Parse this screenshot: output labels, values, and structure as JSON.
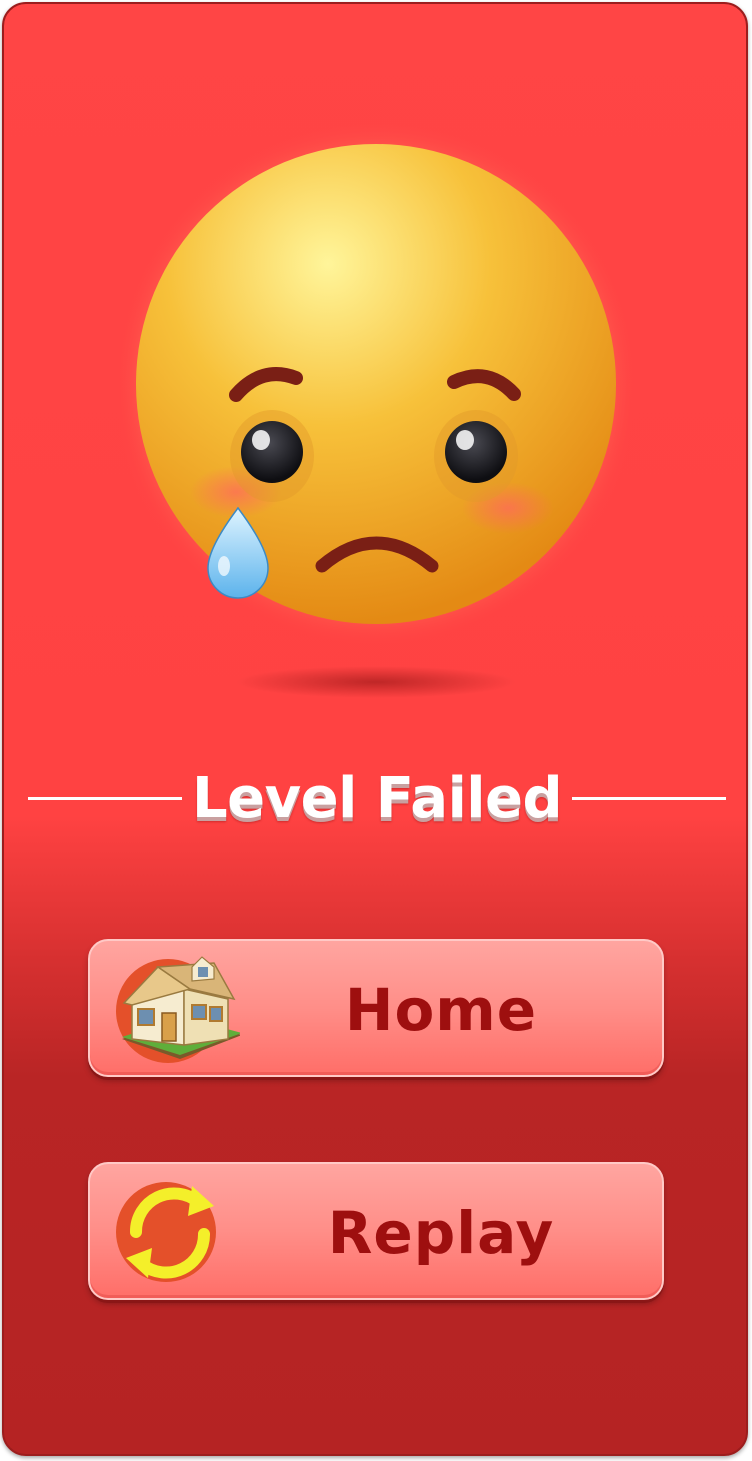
{
  "title": "Level Failed",
  "buttons": {
    "home": {
      "label": "Home",
      "icon": "house-icon"
    },
    "replay": {
      "label": "Replay",
      "icon": "refresh-icon"
    }
  },
  "mascot": {
    "icon": "crying-face-emoji"
  },
  "colors": {
    "panel_top": "#ff4545",
    "panel_bottom": "#b52323",
    "button": "#ff8e88",
    "button_text": "#9e0f0f",
    "title_text": "#ffffff"
  }
}
